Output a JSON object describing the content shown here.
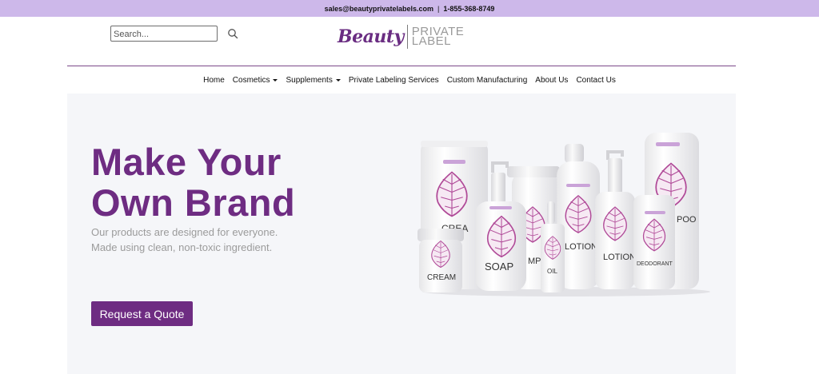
{
  "topbar": {
    "email": "sales@beautyprivatelabels.com",
    "separator": "|",
    "phone": "1-855-368-8749"
  },
  "search": {
    "placeholder": "Search..."
  },
  "logo": {
    "script": "Beauty",
    "line1": "PRIVATE",
    "line2": "LABEL"
  },
  "nav": [
    {
      "label": "Home",
      "dropdown": false
    },
    {
      "label": "Cosmetics",
      "dropdown": true
    },
    {
      "label": "Supplements",
      "dropdown": true
    },
    {
      "label": "Private Labeling Services",
      "dropdown": false
    },
    {
      "label": "Custom Manufacturing",
      "dropdown": false
    },
    {
      "label": "About Us",
      "dropdown": false
    },
    {
      "label": "Contact Us",
      "dropdown": false
    }
  ],
  "hero": {
    "title_line1": "Make Your",
    "title_line2": "Own Brand",
    "subtitle": "Our products are designed for everyone. Made using clean, non-toxic ingredient.",
    "cta": "Request a Quote"
  },
  "product_labels": {
    "cream_tube": "CREA",
    "soap": "SOAP",
    "shampoo": "MP",
    "oil": "OIL",
    "lotion_left": "LOTION",
    "lotion_right": "LOTION",
    "deodorant": "DEODORANT",
    "poo": "POO",
    "cream_jar": "CREAM"
  },
  "colors": {
    "brand": "#6e2c82",
    "topbar": "#cdb8ea",
    "hero_bg": "#f5f6f9",
    "leaf": "#b04a98"
  }
}
